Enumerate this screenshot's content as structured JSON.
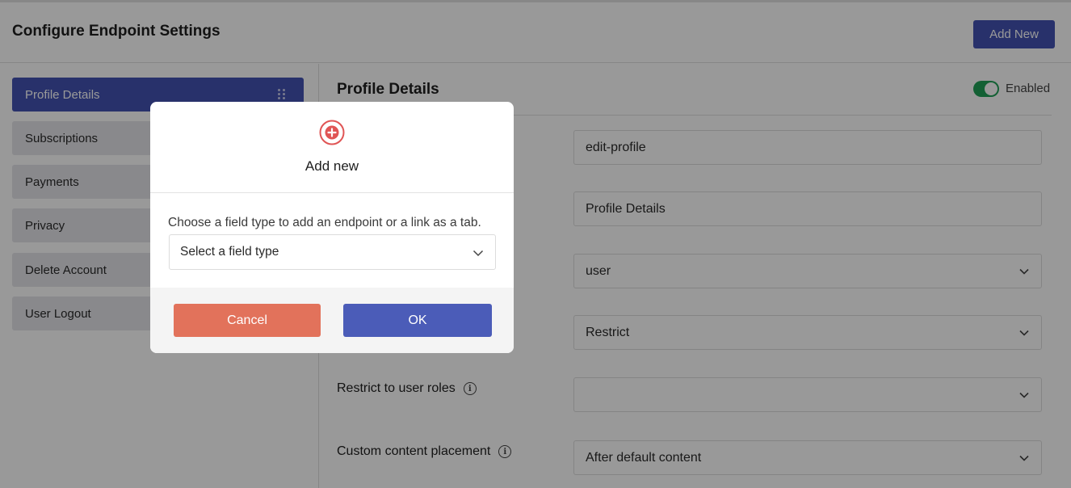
{
  "header": {
    "title": "Configure Endpoint Settings",
    "add_new_label": "Add New"
  },
  "sidebar": {
    "items": [
      {
        "label": "Profile Details",
        "active": true
      },
      {
        "label": "Subscriptions"
      },
      {
        "label": "Payments"
      },
      {
        "label": "Privacy"
      },
      {
        "label": "Delete Account"
      },
      {
        "label": "User Logout"
      }
    ]
  },
  "main": {
    "section_title": "Profile Details",
    "toggle": {
      "label": "Enabled",
      "on": true
    },
    "fields": [
      {
        "label": "",
        "value": "edit-profile"
      },
      {
        "label": "",
        "value": "Profile Details"
      },
      {
        "label": "",
        "value": "user"
      },
      {
        "label": "",
        "value": "Restrict"
      },
      {
        "label": "Restrict to user roles",
        "value": ""
      },
      {
        "label": "Custom content placement",
        "value": "After default content"
      }
    ]
  },
  "modal": {
    "icon": "plus-circle-icon",
    "title": "Add new",
    "description": "Choose a field type to add an endpoint or a link as a tab.",
    "select_value": "Select a field type",
    "cancel_label": "Cancel",
    "ok_label": "OK"
  },
  "colors": {
    "primary": "#4353b3",
    "cancel": "#e2725b",
    "ok": "#4b5cb8",
    "toggle_on": "#21a157",
    "modal_icon": "#e05555"
  }
}
